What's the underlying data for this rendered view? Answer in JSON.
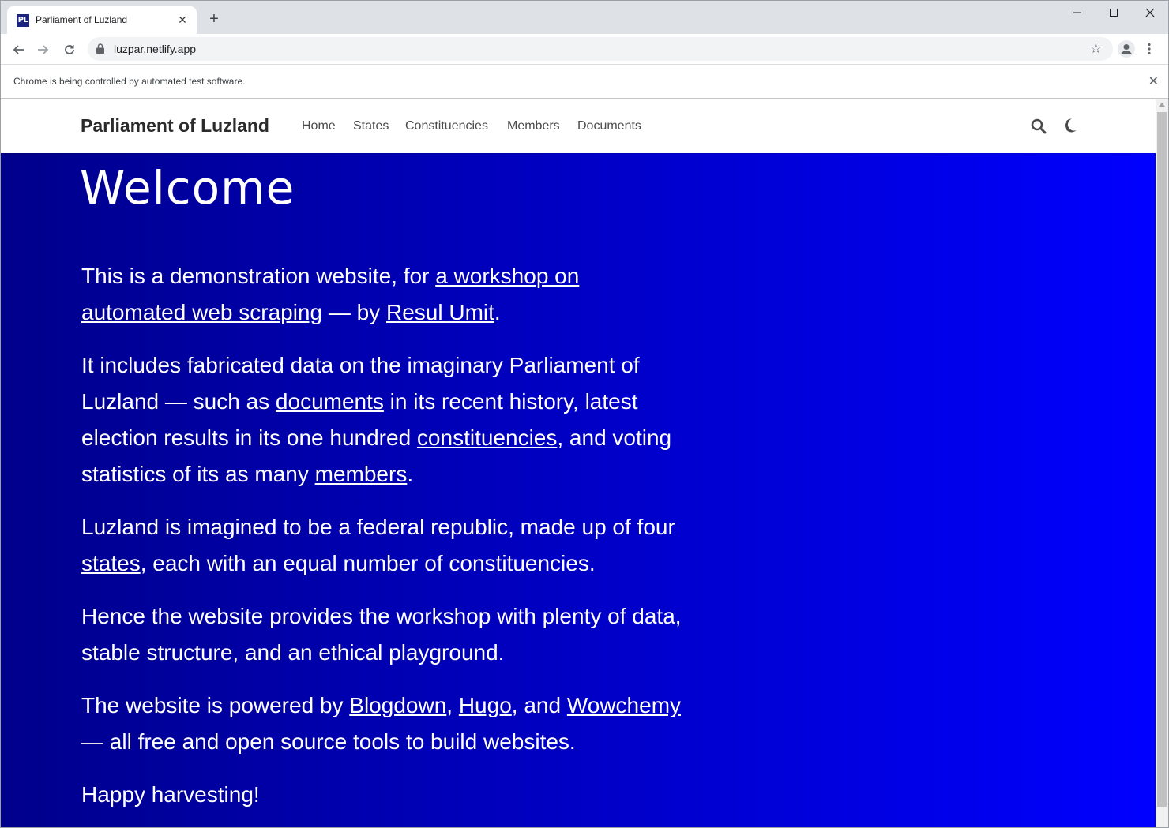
{
  "browser": {
    "tab_favicon_text": "PL",
    "tab_title": "Parliament of Luzland",
    "tab_close": "✕",
    "new_tab": "+",
    "url": "luzpar.netlify.app",
    "infobar_text": "Chrome is being controlled by automated test software.",
    "icons": [
      "back-icon",
      "forward-icon",
      "reload-icon",
      "lock-icon",
      "star-icon",
      "profile-icon",
      "menu-icon",
      "minimize-icon",
      "maximize-icon",
      "close-icon"
    ]
  },
  "site": {
    "brand": "Parliament of Luzland",
    "nav": [
      "Home",
      "States",
      "Constituencies",
      "Members",
      "Documents"
    ],
    "icons": [
      "search-icon",
      "moon-icon"
    ]
  },
  "hero": {
    "title": "Welcome",
    "background_colors": [
      "#00008b",
      "#0000ff"
    ]
  },
  "content": {
    "p1": {
      "t1": "This is a demonstration website, for ",
      "link1": "a workshop on automated web scraping",
      "t2": " — by ",
      "link2": "Resul Umit",
      "t3": "."
    },
    "p2": {
      "t1": "It includes fabricated data on the imaginary Parliament of Luzland — such as ",
      "link1": "documents",
      "t2": " in its recent history, latest election results in its one hundred ",
      "link2": "constituencies",
      "t3": ", and voting statistics of its as many ",
      "link3": "members",
      "t4": "."
    },
    "p3": {
      "t1": "Luzland is imagined to be a federal republic, made up of four ",
      "link1": "states",
      "t2": ", each with an equal number of constituencies."
    },
    "p4": {
      "t1": "Hence the website provides the workshop with plenty of data, stable structure, and an ethical playground."
    },
    "p5": {
      "t1": "The website is powered by ",
      "link1": "Blogdown",
      "t2": ", ",
      "link2": "Hugo",
      "t3": ", and ",
      "link3": "Wowchemy",
      "t4": " — all free and open source tools to build websites."
    },
    "p6": {
      "t1": "Happy harvesting!"
    }
  }
}
